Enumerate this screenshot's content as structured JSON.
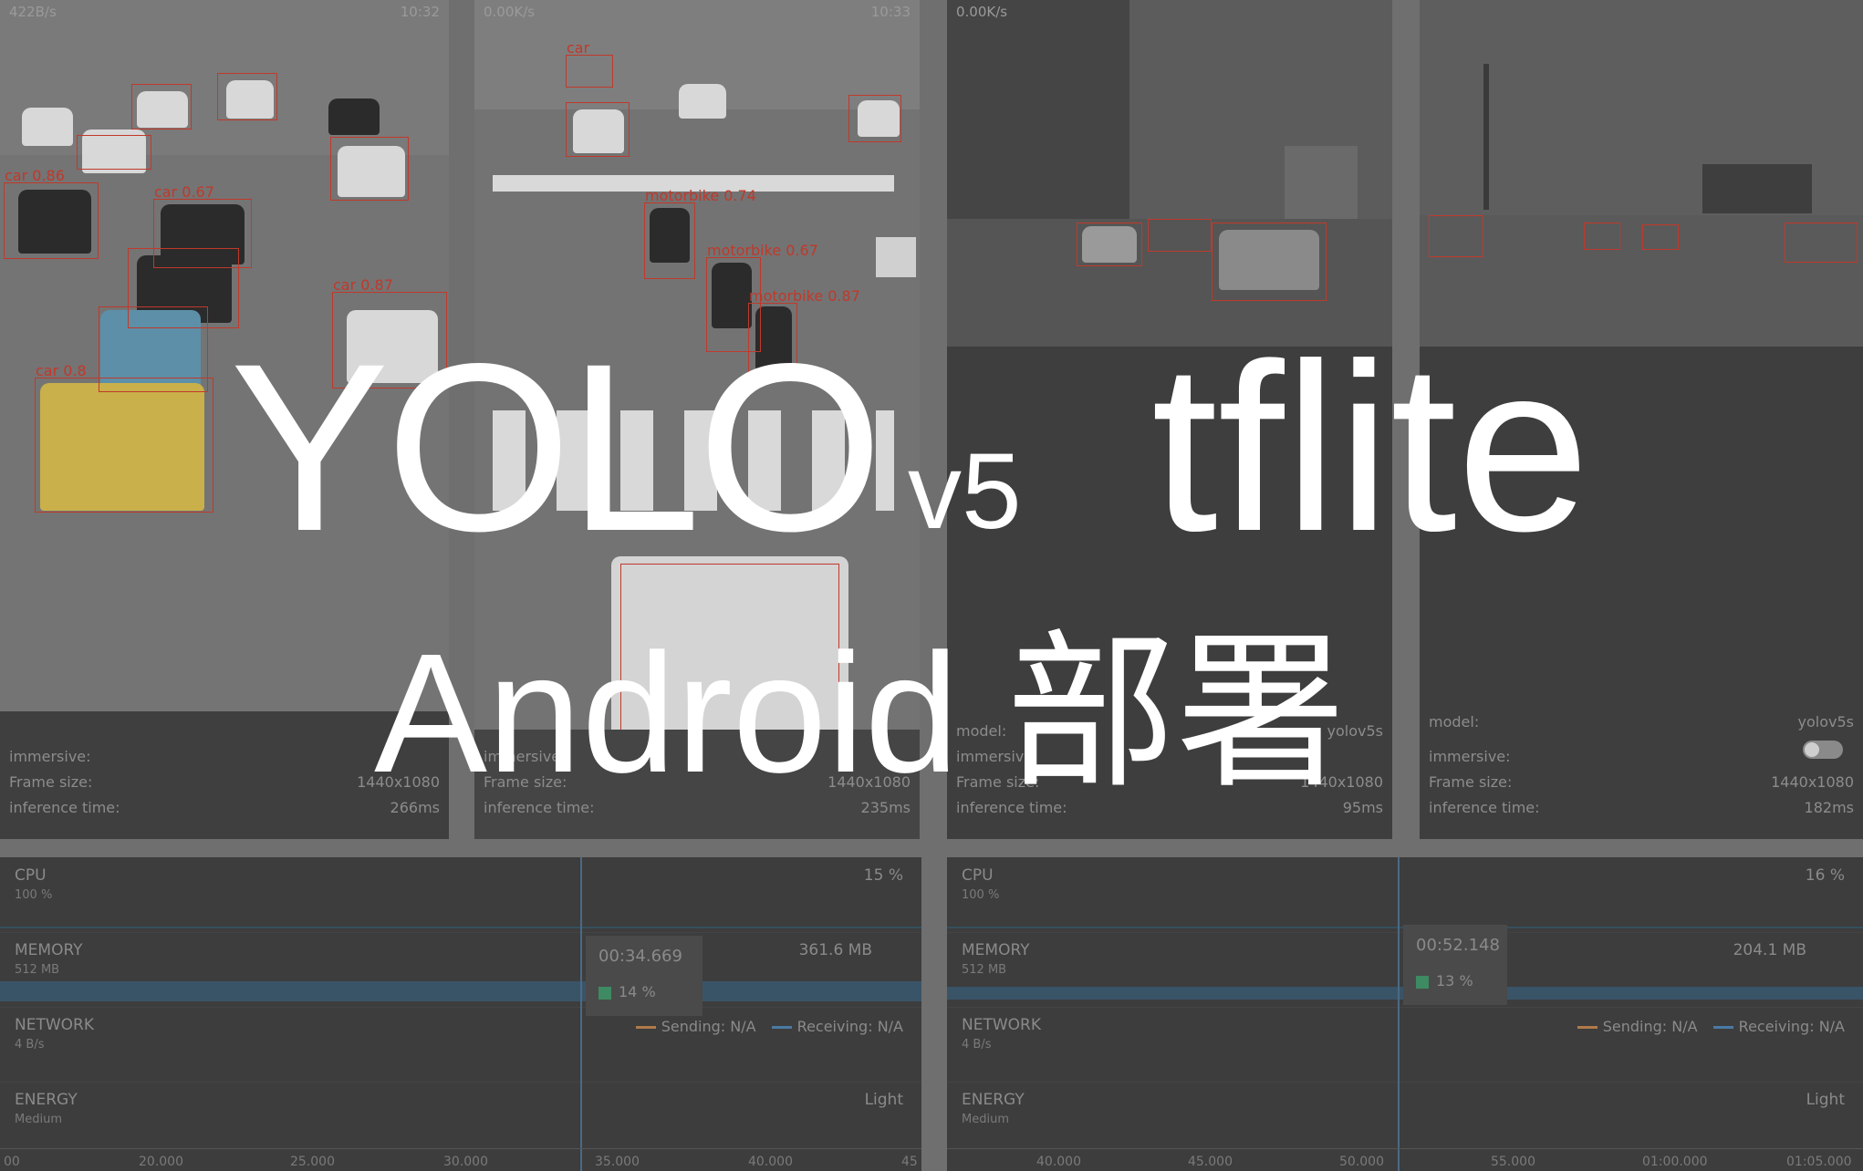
{
  "phones": [
    {
      "status_left": "422B/s",
      "status_right": "10:32",
      "detections": [
        "car 0.86",
        "car 0.67",
        "car 0.87",
        "car 0.8"
      ],
      "info": {
        "immersive_label": "immersive:",
        "frame_label": "Frame size:",
        "frame_value": "1440x1080",
        "time_label": "inference time:",
        "time_value": "266ms"
      }
    },
    {
      "status_left": "0.00K/s",
      "status_right": "10:33",
      "detections": [
        "car",
        "motorbike 0.74",
        "motorbike 0.67",
        "motorbike 0.87"
      ],
      "info": {
        "immersive_label": "immersive:",
        "frame_label": "Frame size:",
        "frame_value": "1440x1080",
        "time_label": "inference time:",
        "time_value": "235ms"
      }
    },
    {
      "status_left": "0.00K/s",
      "status_right": "",
      "detections": [],
      "info": {
        "model_label": "model:",
        "model_value": "yolov5s",
        "immersive_label": "immersive:",
        "frame_label": "Frame size:",
        "frame_value": "1440x1080",
        "time_label": "inference time:",
        "time_value": "95ms"
      }
    },
    {
      "status_left": "",
      "status_right": "",
      "detections": [],
      "info": {
        "model_label": "model:",
        "model_value": "yolov5s",
        "immersive_label": "immersive:",
        "frame_label": "Frame size:",
        "frame_value": "1440x1080",
        "time_label": "inference time:",
        "time_value": "182ms"
      }
    }
  ],
  "profilers": [
    {
      "cpu": {
        "label": "CPU",
        "sub": "100 %",
        "value": "15 %"
      },
      "memory": {
        "label": "MEMORY",
        "sub": "512 MB",
        "value": "361.6 MB"
      },
      "network": {
        "label": "NETWORK",
        "sub": "4 B/s",
        "sending": "Sending: N/A",
        "receiving": "Receiving: N/A"
      },
      "energy": {
        "label": "ENERGY",
        "sub": "Medium",
        "value": "Light"
      },
      "tooltip": {
        "time": "00:34.669",
        "pct": "14 %"
      },
      "axis": [
        "00",
        "20.000",
        "25.000",
        "30.000",
        "35.000",
        "40.000",
        "45"
      ]
    },
    {
      "cpu": {
        "label": "CPU",
        "sub": "100 %",
        "value": "16 %"
      },
      "memory": {
        "label": "MEMORY",
        "sub": "512 MB",
        "value": "204.1 MB"
      },
      "network": {
        "label": "NETWORK",
        "sub": "4 B/s",
        "sending": "Sending: N/A",
        "receiving": "Receiving: N/A"
      },
      "energy": {
        "label": "ENERGY",
        "sub": "Medium",
        "value": "Light"
      },
      "tooltip": {
        "time": "00:52.148",
        "pct": "13 %"
      },
      "axis": [
        "40.000",
        "45.000",
        "50.000",
        "55.000",
        "01:00.000",
        "01:05.000"
      ]
    }
  ],
  "title": {
    "yolo": "YOLO",
    "version": "v5",
    "tflite": "tflite",
    "subtitle": "Android 部署"
  },
  "colors": {
    "detection_box": "#c0392b",
    "memory_bar": "#3a5467",
    "title_text": "#ffffff",
    "sending_line": "#b07a4a",
    "receiving_line": "#4a7aa5"
  }
}
